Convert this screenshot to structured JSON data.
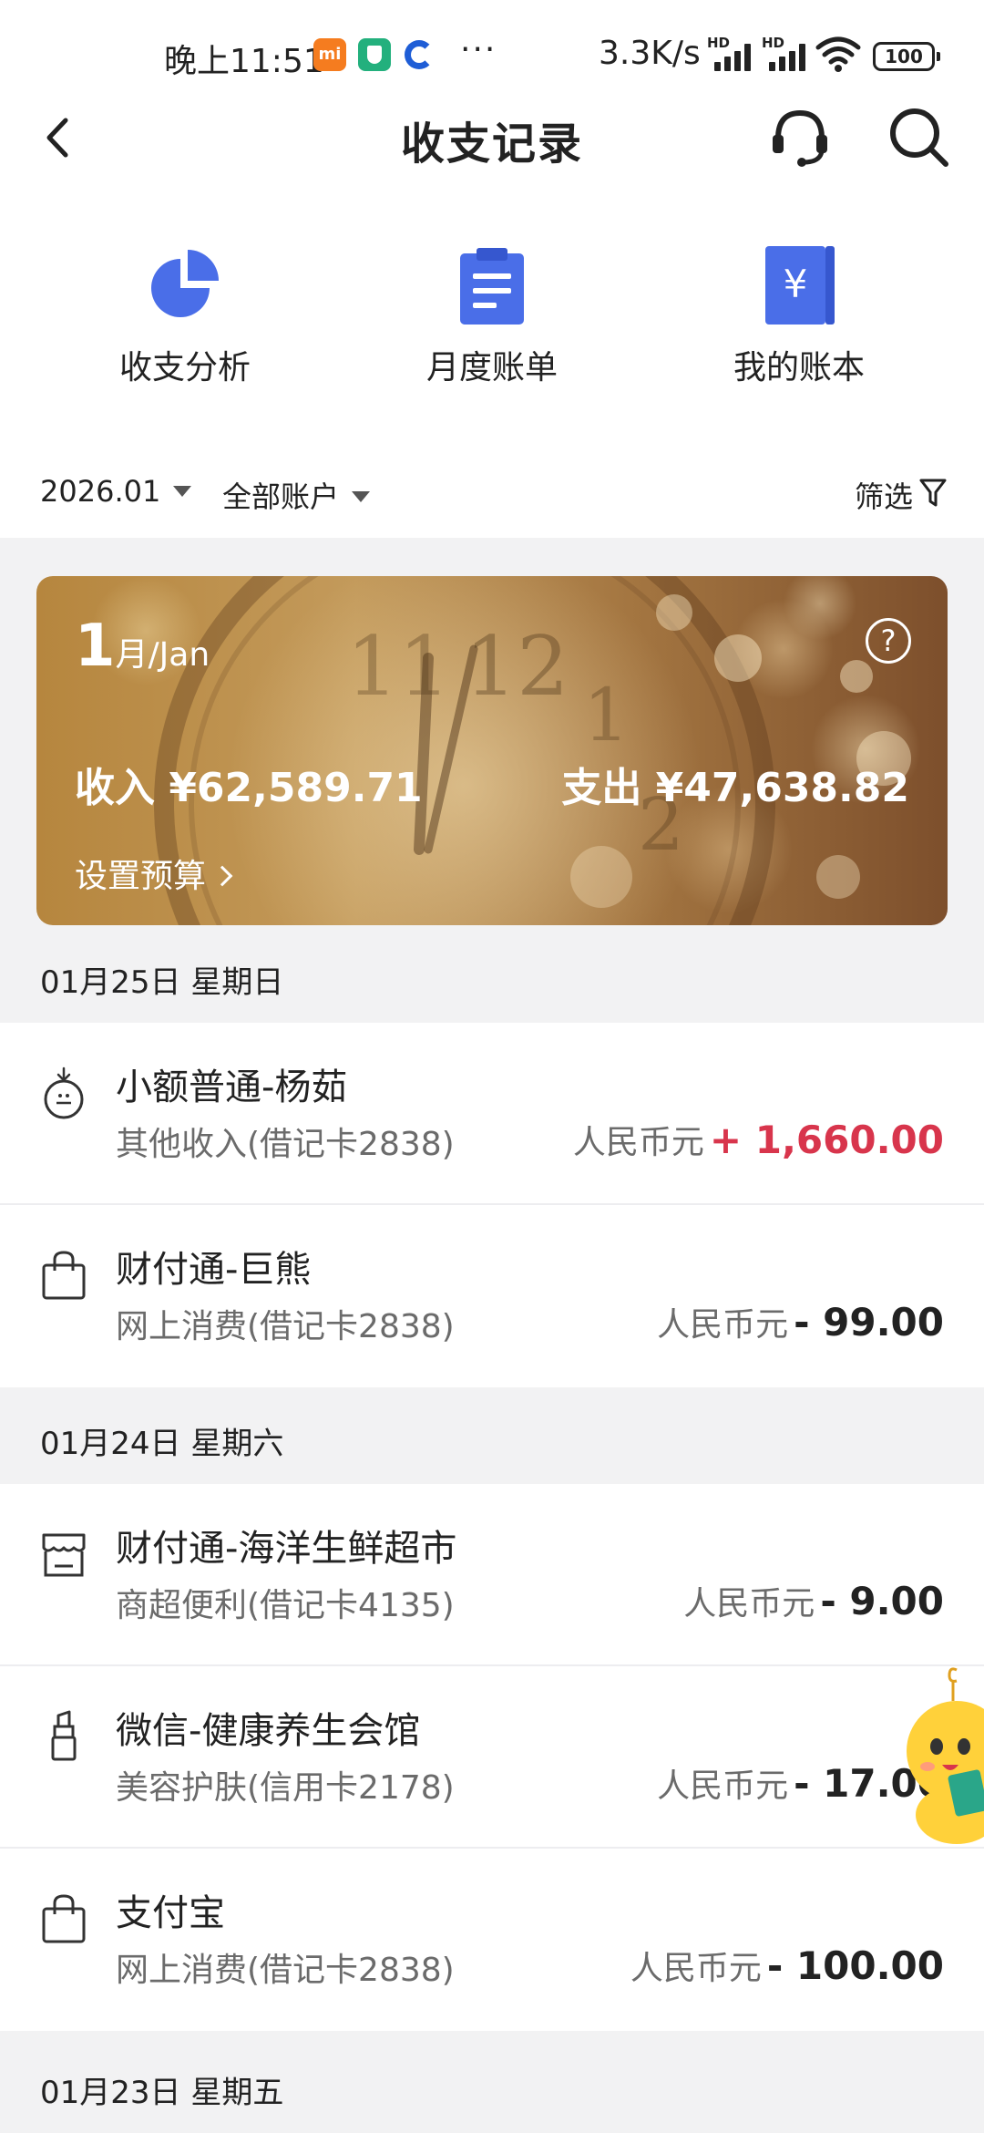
{
  "status_bar": {
    "time": "晚上11:51",
    "mi_badge": "mi",
    "dots": "···",
    "speed": "3.3K/s",
    "hd1": "HD",
    "hd2": "HD",
    "battery": "100"
  },
  "header": {
    "title": "收支记录",
    "icons": [
      "back-icon",
      "customer-service-icon",
      "search-icon"
    ]
  },
  "quick_actions": [
    {
      "label": "收支分析",
      "icon": "pie-chart-icon"
    },
    {
      "label": "月度账单",
      "icon": "clipboard-icon"
    },
    {
      "label": "我的账本",
      "icon": "ledger-book-icon"
    }
  ],
  "filters": {
    "month": "2026.01",
    "account": "全部账户",
    "filter_label": "筛选"
  },
  "month_card": {
    "month_number": "1",
    "month_suffix": "月/Jan",
    "help": "?",
    "income": "收入 ¥62,589.71",
    "expense": "支出 ¥47,638.82",
    "budget": "设置预算"
  },
  "groups": [
    {
      "date": "01月25日 星期日",
      "items": [
        {
          "name": "小额普通-杨茹",
          "category": "其他收入(借记卡2838)",
          "currency": "人民币元",
          "amount": "+ 1,660.00",
          "icon": "money-bag-icon"
        },
        {
          "name": "财付通-巨熊",
          "category": "网上消费(借记卡2838)",
          "currency": "人民币元",
          "amount": "- 99.00",
          "icon": "shopping-bag-icon"
        }
      ]
    },
    {
      "date": "01月24日 星期六",
      "items": [
        {
          "name": "财付通-海洋生鲜超市",
          "category": "商超便利(借记卡4135)",
          "currency": "人民币元",
          "amount": "- 9.00",
          "icon": "store-icon"
        },
        {
          "name": "微信-健康养生会馆",
          "category": "美容护肤(信用卡2178)",
          "currency": "人民币元",
          "amount": "- 17.00",
          "icon": "lipstick-icon"
        },
        {
          "name": "支付宝",
          "category": "网上消费(借记卡2838)",
          "currency": "人民币元",
          "amount": "- 100.00",
          "icon": "shopping-bag-icon"
        }
      ]
    },
    {
      "date": "01月23日 星期五",
      "items": []
    }
  ],
  "colors": {
    "accent_blue": "#4a6ee8",
    "income_red": "#d8354c",
    "card_gold": "#b6863e"
  }
}
